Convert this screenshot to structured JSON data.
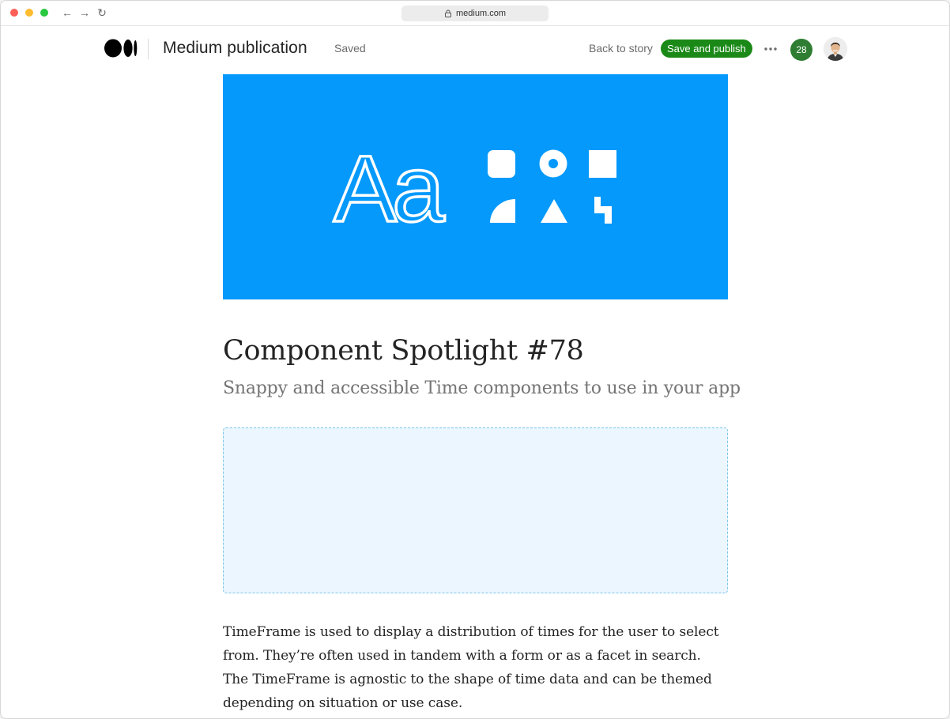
{
  "browser": {
    "url": "medium.com"
  },
  "header": {
    "publication_name": "Medium publication",
    "status": "Saved",
    "back_link": "Back to story",
    "publish_button": "Save and publish",
    "notification_count": "28"
  },
  "hero": {
    "text": "Aa",
    "background_color": "#0499fb"
  },
  "story": {
    "title": "Component Spotlight #78",
    "subtitle": "Snappy and accessible Time components to use in your app",
    "body": "TimeFrame is used to display a distribution of times for the user to select from. They’re often used in tandem with a form or as a facet in search. The TimeFrame is agnostic to the shape of time data and can be themed depending on situation or use case."
  },
  "colors": {
    "publish_green": "#1a8917",
    "badge_green": "#2e7d32",
    "embed_border": "#7cc5ea",
    "embed_fill": "#ebf6fe"
  }
}
